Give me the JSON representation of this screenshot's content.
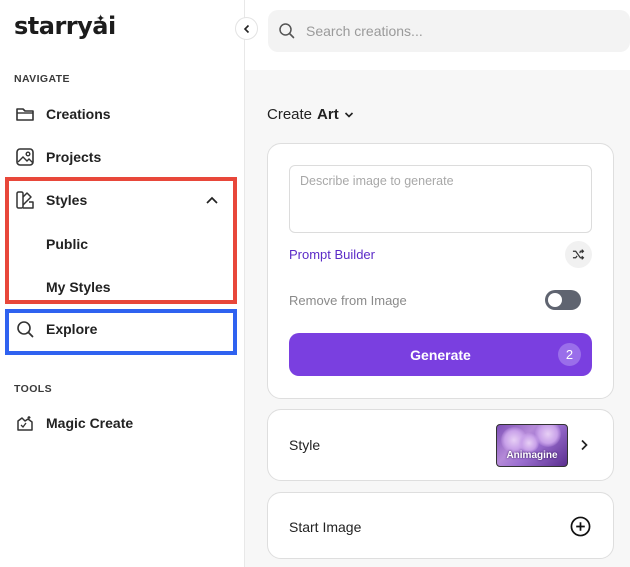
{
  "app": {
    "logo": "starryai"
  },
  "sidebar": {
    "navigate_label": "NAVIGATE",
    "tools_label": "TOOLS",
    "items": [
      {
        "label": "Creations",
        "icon": "folder-icon"
      },
      {
        "label": "Projects",
        "icon": "image-icon"
      },
      {
        "label": "Styles",
        "icon": "palette-icon",
        "expanded": true
      },
      {
        "label": "Explore",
        "icon": "search-icon"
      }
    ],
    "styles_sub": [
      {
        "label": "Public"
      },
      {
        "label": "My Styles"
      }
    ],
    "tools": [
      {
        "label": "Magic Create",
        "icon": "magic-create-icon"
      }
    ]
  },
  "search": {
    "placeholder": "Search creations..."
  },
  "create": {
    "prefix": "Create",
    "mode": "Art",
    "prompt_placeholder": "Describe image to generate",
    "prompt_builder": "Prompt Builder",
    "remove_label": "Remove from Image",
    "remove_enabled": false,
    "generate_label": "Generate",
    "generate_count": "2"
  },
  "style": {
    "label": "Style",
    "selected": "Animagine"
  },
  "start_image": {
    "label": "Start Image"
  },
  "colors": {
    "accent": "#7a3fe0",
    "link": "#5b2bc7",
    "highlight_red": "#e8473a",
    "highlight_blue": "#2f62f0"
  }
}
